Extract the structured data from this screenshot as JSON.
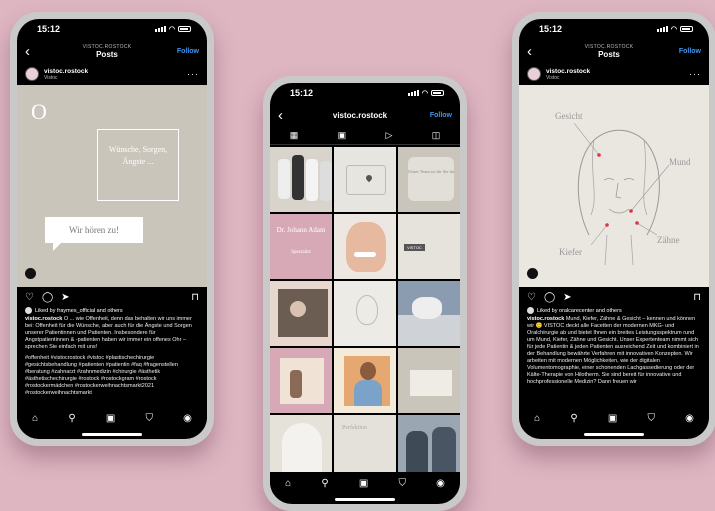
{
  "status": {
    "time": "15:12"
  },
  "left": {
    "header": {
      "username": "VISTOC.ROSTOCK",
      "title": "Posts",
      "follow": "Follow"
    },
    "post_header": {
      "user": "vistoc.rostock",
      "location": "Vistoc"
    },
    "image": {
      "logo": "O",
      "card_text": "Wünsche, Sorgen, Ängste ...",
      "bubble_text": "Wir hören zu!"
    },
    "liked_by": "Liked by fraymes_official and others",
    "caption_user": "vistoc.rostock",
    "caption": "O ... wie Offenheit, denn das behalten wir uns immer bei: Offenheit für die Wünsche, aber auch für die Ängste und Sorgen unserer Patientinnen und Patienten. Insbesondere für Angstpatientinnen & -patienten haben wir immer ein offenes Ohr – sprechen Sie einfach mit uns!",
    "hashtags": "#offenheit #vistocrostock #vistoc #plastischechirurgie #gesichtsbehandlung #patienten #patientin #faq #fragenstellen #beratung #zahnarzt #zahnmedizin #chirurgie #ästhetik #ästhetischechirurgie #rostock #rostockgram #rostock #rostockermädchen #rostockerweihnachtsmarkt2021 #rostockerweihnachtsmarkt"
  },
  "middle": {
    "header": {
      "title": "vistoc.rostock",
      "follow": "Follow"
    },
    "tiles": {
      "t3": "Unser Team ist für Sie da",
      "t4": "Dr. Johann Adam",
      "t4sub": "Spezialist",
      "t6": "VISTOC",
      "t15": "Perfektion"
    }
  },
  "right": {
    "header": {
      "username": "VISTOC.ROSTOCK",
      "title": "Posts",
      "follow": "Follow"
    },
    "post_header": {
      "user": "vistoc.rostock",
      "location": "Vistoc"
    },
    "image": {
      "label_face": "Gesicht",
      "label_mouth": "Mund",
      "label_jaw": "Kiefer",
      "label_teeth": "Zähne"
    },
    "liked_by": "Liked by oralcarecenter and others",
    "caption_user": "vistoc.rostock",
    "caption": "Mund, Kiefer, Zähne & Gesicht – kennen und können wir 🙂 VISTOC deckt alle Facetten der modernen MKG- und Oralchirurgie ab und bietet Ihnen ein breites Leistungsspektrum rund um Mund, Kiefer, Zähne und Gesicht. Unser Expertenteam nimmt sich für jede Patientin & jeden Patienten ausreichend Zeit und kombiniert in der Behandlung bewährte Verfahren mit innovativen Konzepten. Wir arbeiten mit modernen Möglichkeiten, wie der digitalen Volumentomographie, einer schonenden Lachgassedierung oder der Kälte-Therapie von Hilotherm. Sie sind bereit für innovative und hochprofessionelle Medizin? Dann freuen wir"
  },
  "icons": {
    "back": "back-arrow-icon",
    "heart": "heart-icon",
    "comment": "comment-icon",
    "share": "share-icon",
    "save": "bookmark-icon",
    "home": "home-icon",
    "search": "search-icon",
    "reels": "reels-icon",
    "shop": "shop-icon",
    "profile": "profile-icon"
  },
  "colors": {
    "background": "#deb6c2",
    "accent_blue": "#3e97f0",
    "tile_pink": "#d7a9b6",
    "tile_beige": "#c9c5bb"
  }
}
